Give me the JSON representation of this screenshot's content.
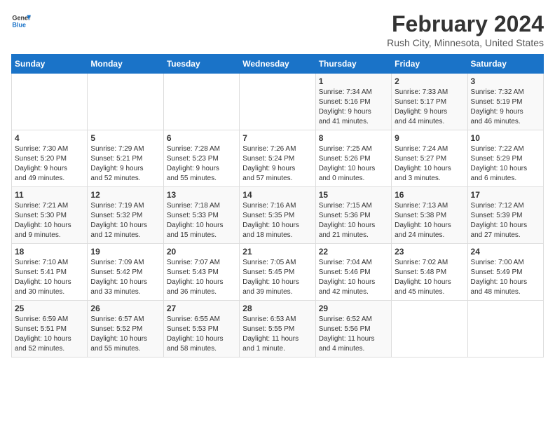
{
  "header": {
    "logo_line1": "General",
    "logo_line2": "Blue",
    "title": "February 2024",
    "subtitle": "Rush City, Minnesota, United States"
  },
  "days_of_week": [
    "Sunday",
    "Monday",
    "Tuesday",
    "Wednesday",
    "Thursday",
    "Friday",
    "Saturday"
  ],
  "weeks": [
    [
      {
        "day": "",
        "info": ""
      },
      {
        "day": "",
        "info": ""
      },
      {
        "day": "",
        "info": ""
      },
      {
        "day": "",
        "info": ""
      },
      {
        "day": "1",
        "info": "Sunrise: 7:34 AM\nSunset: 5:16 PM\nDaylight: 9 hours\nand 41 minutes."
      },
      {
        "day": "2",
        "info": "Sunrise: 7:33 AM\nSunset: 5:17 PM\nDaylight: 9 hours\nand 44 minutes."
      },
      {
        "day": "3",
        "info": "Sunrise: 7:32 AM\nSunset: 5:19 PM\nDaylight: 9 hours\nand 46 minutes."
      }
    ],
    [
      {
        "day": "4",
        "info": "Sunrise: 7:30 AM\nSunset: 5:20 PM\nDaylight: 9 hours\nand 49 minutes."
      },
      {
        "day": "5",
        "info": "Sunrise: 7:29 AM\nSunset: 5:21 PM\nDaylight: 9 hours\nand 52 minutes."
      },
      {
        "day": "6",
        "info": "Sunrise: 7:28 AM\nSunset: 5:23 PM\nDaylight: 9 hours\nand 55 minutes."
      },
      {
        "day": "7",
        "info": "Sunrise: 7:26 AM\nSunset: 5:24 PM\nDaylight: 9 hours\nand 57 minutes."
      },
      {
        "day": "8",
        "info": "Sunrise: 7:25 AM\nSunset: 5:26 PM\nDaylight: 10 hours\nand 0 minutes."
      },
      {
        "day": "9",
        "info": "Sunrise: 7:24 AM\nSunset: 5:27 PM\nDaylight: 10 hours\nand 3 minutes."
      },
      {
        "day": "10",
        "info": "Sunrise: 7:22 AM\nSunset: 5:29 PM\nDaylight: 10 hours\nand 6 minutes."
      }
    ],
    [
      {
        "day": "11",
        "info": "Sunrise: 7:21 AM\nSunset: 5:30 PM\nDaylight: 10 hours\nand 9 minutes."
      },
      {
        "day": "12",
        "info": "Sunrise: 7:19 AM\nSunset: 5:32 PM\nDaylight: 10 hours\nand 12 minutes."
      },
      {
        "day": "13",
        "info": "Sunrise: 7:18 AM\nSunset: 5:33 PM\nDaylight: 10 hours\nand 15 minutes."
      },
      {
        "day": "14",
        "info": "Sunrise: 7:16 AM\nSunset: 5:35 PM\nDaylight: 10 hours\nand 18 minutes."
      },
      {
        "day": "15",
        "info": "Sunrise: 7:15 AM\nSunset: 5:36 PM\nDaylight: 10 hours\nand 21 minutes."
      },
      {
        "day": "16",
        "info": "Sunrise: 7:13 AM\nSunset: 5:38 PM\nDaylight: 10 hours\nand 24 minutes."
      },
      {
        "day": "17",
        "info": "Sunrise: 7:12 AM\nSunset: 5:39 PM\nDaylight: 10 hours\nand 27 minutes."
      }
    ],
    [
      {
        "day": "18",
        "info": "Sunrise: 7:10 AM\nSunset: 5:41 PM\nDaylight: 10 hours\nand 30 minutes."
      },
      {
        "day": "19",
        "info": "Sunrise: 7:09 AM\nSunset: 5:42 PM\nDaylight: 10 hours\nand 33 minutes."
      },
      {
        "day": "20",
        "info": "Sunrise: 7:07 AM\nSunset: 5:43 PM\nDaylight: 10 hours\nand 36 minutes."
      },
      {
        "day": "21",
        "info": "Sunrise: 7:05 AM\nSunset: 5:45 PM\nDaylight: 10 hours\nand 39 minutes."
      },
      {
        "day": "22",
        "info": "Sunrise: 7:04 AM\nSunset: 5:46 PM\nDaylight: 10 hours\nand 42 minutes."
      },
      {
        "day": "23",
        "info": "Sunrise: 7:02 AM\nSunset: 5:48 PM\nDaylight: 10 hours\nand 45 minutes."
      },
      {
        "day": "24",
        "info": "Sunrise: 7:00 AM\nSunset: 5:49 PM\nDaylight: 10 hours\nand 48 minutes."
      }
    ],
    [
      {
        "day": "25",
        "info": "Sunrise: 6:59 AM\nSunset: 5:51 PM\nDaylight: 10 hours\nand 52 minutes."
      },
      {
        "day": "26",
        "info": "Sunrise: 6:57 AM\nSunset: 5:52 PM\nDaylight: 10 hours\nand 55 minutes."
      },
      {
        "day": "27",
        "info": "Sunrise: 6:55 AM\nSunset: 5:53 PM\nDaylight: 10 hours\nand 58 minutes."
      },
      {
        "day": "28",
        "info": "Sunrise: 6:53 AM\nSunset: 5:55 PM\nDaylight: 11 hours\nand 1 minute."
      },
      {
        "day": "29",
        "info": "Sunrise: 6:52 AM\nSunset: 5:56 PM\nDaylight: 11 hours\nand 4 minutes."
      },
      {
        "day": "",
        "info": ""
      },
      {
        "day": "",
        "info": ""
      }
    ]
  ]
}
